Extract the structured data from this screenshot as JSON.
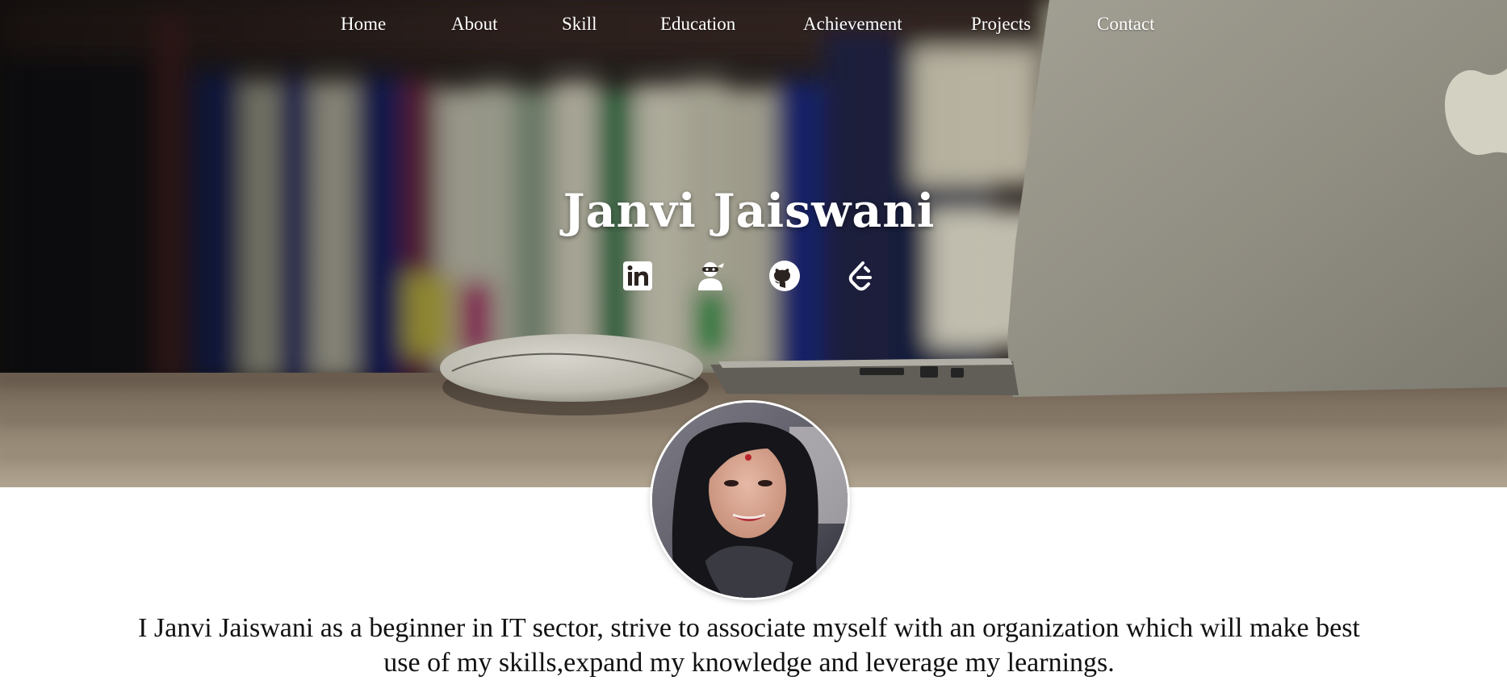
{
  "nav": {
    "items": [
      {
        "label": "Home",
        "name": "nav-home"
      },
      {
        "label": "About",
        "name": "nav-about"
      },
      {
        "label": "Skill",
        "name": "nav-skill"
      },
      {
        "label": "Education",
        "name": "nav-education"
      },
      {
        "label": "Achievement",
        "name": "nav-achievement"
      },
      {
        "label": "Projects",
        "name": "nav-projects"
      },
      {
        "label": "Contact",
        "name": "nav-contact"
      }
    ]
  },
  "hero": {
    "title": "Janvi Jaiswani",
    "social_icons": [
      "linkedin-icon",
      "hackerrank-ninja-icon",
      "github-icon",
      "leetcode-icon"
    ]
  },
  "bio": {
    "text": "I Janvi Jaiswani as a beginner in IT sector, strive to associate myself with an organization which will make best use of my skills,expand my knowledge and leverage my learnings."
  },
  "colors": {
    "nav_text": "#ffffff",
    "hero_title": "#ffffff",
    "bio_text": "#111111",
    "page_background": "#ffffff"
  }
}
